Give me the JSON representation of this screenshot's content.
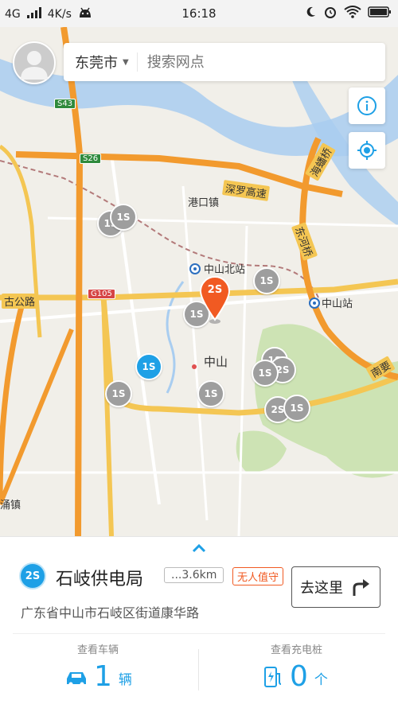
{
  "status_bar": {
    "network": "4G",
    "speed": "4K/s",
    "time": "16:18"
  },
  "search": {
    "city": "东莞市",
    "placeholder": "搜索网点"
  },
  "map": {
    "labels": {
      "gangkou": "港口镇",
      "zhongshan_north_station": "中山北站",
      "zhongshan_station": "中山站",
      "zhongshan_city": "中山",
      "shenluo_expressway": "深罗高速",
      "gu_road": "古公路",
      "haibang_bridge": "海蟠桥",
      "donghe_bridge": "东河桥",
      "nanhai": "南要",
      "yongzhen": "涌镇"
    },
    "shields": {
      "s43": "S43",
      "s26": "S26",
      "g105": "G105"
    },
    "markers": [
      {
        "label": "1S",
        "style": "gray"
      },
      {
        "label": "1S",
        "style": "gray"
      },
      {
        "label": "1S",
        "style": "gray"
      },
      {
        "label": "1S",
        "style": "gray"
      },
      {
        "label": "1S",
        "style": "blue"
      },
      {
        "label": "1S",
        "style": "gray"
      },
      {
        "label": "1S",
        "style": "gray"
      },
      {
        "label": "1S",
        "style": "gray"
      },
      {
        "label": "2S",
        "style": "gray"
      },
      {
        "label": "1S",
        "style": "gray"
      },
      {
        "label": "2S",
        "style": "gray"
      },
      {
        "label": "1S",
        "style": "gray"
      }
    ],
    "selected_pin": "2S"
  },
  "panel": {
    "station_badge": "2S",
    "station_name": "石岐供电局",
    "distance": "...3.6km",
    "unattended_tag": "无人值守",
    "goto_label": "去这里",
    "address": "广东省中山市石岐区街道康华路",
    "vehicles_title": "查看车辆",
    "vehicles_count": "1",
    "vehicles_unit": "辆",
    "chargers_title": "查看充电桩",
    "chargers_count": "0",
    "chargers_unit": "个"
  },
  "colors": {
    "accent": "#1ea0e6",
    "selected_pin": "#f15a22",
    "road_orange": "#f29a2e",
    "road_yellow": "#f4c653",
    "water": "#a9cdf0",
    "green": "#b8d89b"
  }
}
